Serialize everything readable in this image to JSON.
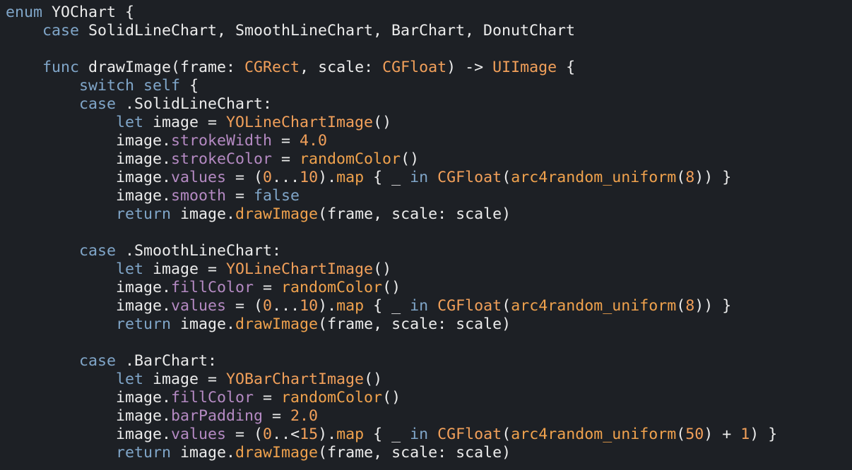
{
  "editor": {
    "background": "#1d2025",
    "colors": {
      "keyword": "#80a6c9",
      "plain": "#ececec",
      "type": "#f2a05a",
      "property": "#b58ac3",
      "function": "#f0a24d",
      "number": "#f2a05a"
    },
    "lines": [
      [
        {
          "t": "kw",
          "v": "enum"
        },
        {
          "t": "plain",
          "v": " YOChart {"
        }
      ],
      [
        {
          "t": "plain",
          "v": "    "
        },
        {
          "t": "kw",
          "v": "case"
        },
        {
          "t": "plain",
          "v": " SolidLineChart, SmoothLineChart, BarChart, DonutChart"
        }
      ],
      [],
      [
        {
          "t": "plain",
          "v": "    "
        },
        {
          "t": "kw",
          "v": "func"
        },
        {
          "t": "plain",
          "v": " drawImage(frame: "
        },
        {
          "t": "type",
          "v": "CGRect"
        },
        {
          "t": "plain",
          "v": ", scale: "
        },
        {
          "t": "type",
          "v": "CGFloat"
        },
        {
          "t": "plain",
          "v": ") -> "
        },
        {
          "t": "type",
          "v": "UIImage"
        },
        {
          "t": "plain",
          "v": " {"
        }
      ],
      [
        {
          "t": "plain",
          "v": "        "
        },
        {
          "t": "kw",
          "v": "switch"
        },
        {
          "t": "plain",
          "v": " "
        },
        {
          "t": "kw",
          "v": "self"
        },
        {
          "t": "plain",
          "v": " {"
        }
      ],
      [
        {
          "t": "plain",
          "v": "        "
        },
        {
          "t": "kw",
          "v": "case"
        },
        {
          "t": "plain",
          "v": " .SolidLineChart:"
        }
      ],
      [
        {
          "t": "plain",
          "v": "            "
        },
        {
          "t": "kw",
          "v": "let"
        },
        {
          "t": "plain",
          "v": " image = "
        },
        {
          "t": "type",
          "v": "YOLineChartImage"
        },
        {
          "t": "plain",
          "v": "()"
        }
      ],
      [
        {
          "t": "plain",
          "v": "            image."
        },
        {
          "t": "prop",
          "v": "strokeWidth"
        },
        {
          "t": "plain",
          "v": " = "
        },
        {
          "t": "num",
          "v": "4.0"
        }
      ],
      [
        {
          "t": "plain",
          "v": "            image."
        },
        {
          "t": "prop",
          "v": "strokeColor"
        },
        {
          "t": "plain",
          "v": " = "
        },
        {
          "t": "func",
          "v": "randomColor"
        },
        {
          "t": "plain",
          "v": "()"
        }
      ],
      [
        {
          "t": "plain",
          "v": "            image."
        },
        {
          "t": "prop",
          "v": "values"
        },
        {
          "t": "plain",
          "v": " = ("
        },
        {
          "t": "num",
          "v": "0"
        },
        {
          "t": "plain",
          "v": "..."
        },
        {
          "t": "num",
          "v": "10"
        },
        {
          "t": "plain",
          "v": ")."
        },
        {
          "t": "func",
          "v": "map"
        },
        {
          "t": "plain",
          "v": " { _ "
        },
        {
          "t": "kw",
          "v": "in"
        },
        {
          "t": "plain",
          "v": " "
        },
        {
          "t": "type",
          "v": "CGFloat"
        },
        {
          "t": "plain",
          "v": "("
        },
        {
          "t": "func",
          "v": "arc4random_uniform"
        },
        {
          "t": "plain",
          "v": "("
        },
        {
          "t": "num",
          "v": "8"
        },
        {
          "t": "plain",
          "v": ")) }"
        }
      ],
      [
        {
          "t": "plain",
          "v": "            image."
        },
        {
          "t": "prop",
          "v": "smooth"
        },
        {
          "t": "plain",
          "v": " = "
        },
        {
          "t": "kw",
          "v": "false"
        }
      ],
      [
        {
          "t": "plain",
          "v": "            "
        },
        {
          "t": "kw",
          "v": "return"
        },
        {
          "t": "plain",
          "v": " image."
        },
        {
          "t": "func",
          "v": "drawImage"
        },
        {
          "t": "plain",
          "v": "(frame, scale: scale)"
        }
      ],
      [],
      [
        {
          "t": "plain",
          "v": "        "
        },
        {
          "t": "kw",
          "v": "case"
        },
        {
          "t": "plain",
          "v": " .SmoothLineChart:"
        }
      ],
      [
        {
          "t": "plain",
          "v": "            "
        },
        {
          "t": "kw",
          "v": "let"
        },
        {
          "t": "plain",
          "v": " image = "
        },
        {
          "t": "type",
          "v": "YOLineChartImage"
        },
        {
          "t": "plain",
          "v": "()"
        }
      ],
      [
        {
          "t": "plain",
          "v": "            image."
        },
        {
          "t": "prop",
          "v": "fillColor"
        },
        {
          "t": "plain",
          "v": " = "
        },
        {
          "t": "func",
          "v": "randomColor"
        },
        {
          "t": "plain",
          "v": "()"
        }
      ],
      [
        {
          "t": "plain",
          "v": "            image."
        },
        {
          "t": "prop",
          "v": "values"
        },
        {
          "t": "plain",
          "v": " = ("
        },
        {
          "t": "num",
          "v": "0"
        },
        {
          "t": "plain",
          "v": "..."
        },
        {
          "t": "num",
          "v": "10"
        },
        {
          "t": "plain",
          "v": ")."
        },
        {
          "t": "func",
          "v": "map"
        },
        {
          "t": "plain",
          "v": " { _ "
        },
        {
          "t": "kw",
          "v": "in"
        },
        {
          "t": "plain",
          "v": " "
        },
        {
          "t": "type",
          "v": "CGFloat"
        },
        {
          "t": "plain",
          "v": "("
        },
        {
          "t": "func",
          "v": "arc4random_uniform"
        },
        {
          "t": "plain",
          "v": "("
        },
        {
          "t": "num",
          "v": "8"
        },
        {
          "t": "plain",
          "v": ")) }"
        }
      ],
      [
        {
          "t": "plain",
          "v": "            "
        },
        {
          "t": "kw",
          "v": "return"
        },
        {
          "t": "plain",
          "v": " image."
        },
        {
          "t": "func",
          "v": "drawImage"
        },
        {
          "t": "plain",
          "v": "(frame, scale: scale)"
        }
      ],
      [],
      [
        {
          "t": "plain",
          "v": "        "
        },
        {
          "t": "kw",
          "v": "case"
        },
        {
          "t": "plain",
          "v": " .BarChart:"
        }
      ],
      [
        {
          "t": "plain",
          "v": "            "
        },
        {
          "t": "kw",
          "v": "let"
        },
        {
          "t": "plain",
          "v": " image = "
        },
        {
          "t": "type",
          "v": "YOBarChartImage"
        },
        {
          "t": "plain",
          "v": "()"
        }
      ],
      [
        {
          "t": "plain",
          "v": "            image."
        },
        {
          "t": "prop",
          "v": "fillColor"
        },
        {
          "t": "plain",
          "v": " = "
        },
        {
          "t": "func",
          "v": "randomColor"
        },
        {
          "t": "plain",
          "v": "()"
        }
      ],
      [
        {
          "t": "plain",
          "v": "            image."
        },
        {
          "t": "prop",
          "v": "barPadding"
        },
        {
          "t": "plain",
          "v": " = "
        },
        {
          "t": "num",
          "v": "2.0"
        }
      ],
      [
        {
          "t": "plain",
          "v": "            image."
        },
        {
          "t": "prop",
          "v": "values"
        },
        {
          "t": "plain",
          "v": " = ("
        },
        {
          "t": "num",
          "v": "0"
        },
        {
          "t": "plain",
          "v": "..<"
        },
        {
          "t": "num",
          "v": "15"
        },
        {
          "t": "plain",
          "v": ")."
        },
        {
          "t": "func",
          "v": "map"
        },
        {
          "t": "plain",
          "v": " { _ "
        },
        {
          "t": "kw",
          "v": "in"
        },
        {
          "t": "plain",
          "v": " "
        },
        {
          "t": "type",
          "v": "CGFloat"
        },
        {
          "t": "plain",
          "v": "("
        },
        {
          "t": "func",
          "v": "arc4random_uniform"
        },
        {
          "t": "plain",
          "v": "("
        },
        {
          "t": "num",
          "v": "50"
        },
        {
          "t": "plain",
          "v": ") + "
        },
        {
          "t": "num",
          "v": "1"
        },
        {
          "t": "plain",
          "v": ") }"
        }
      ],
      [
        {
          "t": "plain",
          "v": "            "
        },
        {
          "t": "kw",
          "v": "return"
        },
        {
          "t": "plain",
          "v": " image."
        },
        {
          "t": "func",
          "v": "drawImage"
        },
        {
          "t": "plain",
          "v": "(frame, scale: scale)"
        }
      ]
    ]
  }
}
